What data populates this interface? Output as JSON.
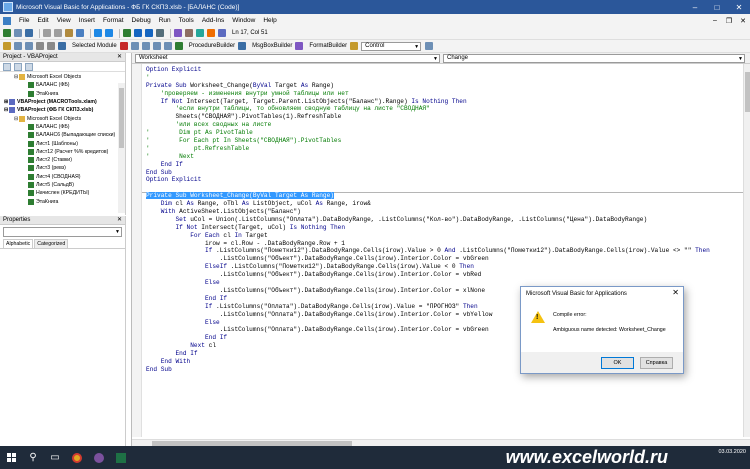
{
  "window": {
    "title": "Microsoft Visual Basic for Applications - ФБ ГК СКПЗ.xlsb - [БАЛАНС (Code)]"
  },
  "menu": [
    "File",
    "Edit",
    "View",
    "Insert",
    "Format",
    "Debug",
    "Run",
    "Tools",
    "Add-Ins",
    "Window",
    "Help"
  ],
  "toolbar": {
    "status": "Ln 17, Col 51"
  },
  "toolbar2": {
    "selected_module": "Selected Module",
    "proc_builder": "ProcedureBuilder",
    "msgbox_builder": "MsgBoxBuilder",
    "form_builder": "FormatBuilder",
    "control": "Control"
  },
  "project": {
    "title": "Project - VBAProject",
    "items": [
      "Microsoft Excel Objects",
      "БАЛАНС (ФБ)",
      "ЭтаКнига",
      "VBAProject (MACROTools.xlam)",
      "VBAProject (ФБ ГК СКПЗ.xlsb)",
      "Microsoft Excel Objects",
      "БАЛАНС (ФБ)",
      "БАЛАНС6 (Выпадающие списки)",
      "Лист1 (Шаблоны)",
      "Лист12 (Расчет %% кредитов)",
      "Лист2 (Ставки)",
      "Лист3 (ревз)",
      "Лист4 (СВОДНАЯ)",
      "Лист5 (СальдВ)",
      "Начислен (КРЕДИТЫ)",
      "ЭтаКнига"
    ]
  },
  "properties": {
    "title": "Properties",
    "tab_alpha": "Alphabetic",
    "tab_cat": "Categorized"
  },
  "code": {
    "object": "Worksheet",
    "procedure": "Change",
    "lines": [
      "Option Explicit",
      "'",
      "Private Sub Worksheet_Change(ByVal Target As Range)",
      "    'проверяем - изменения внутри умной таблицы или нет",
      "    If Not Intersect(Target, Target.Parent.ListObjects(\"Баланс\").Range) Is Nothing Then",
      "        'если внутри таблицы, то обновляем сводную таблицу на листе \"СВОДНАЯ\"",
      "        Sheets(\"СВОДНАЯ\").PivotTables(1).RefreshTable",
      "        'или всех сводных на листе",
      "'        Dim pt As PivotTable",
      "'        For Each pt In Sheets(\"СВОДНАЯ\").PivotTables",
      "'            pt.RefreshTable",
      "'        Next",
      "    End If",
      "End Sub",
      "Option Explicit",
      "",
      "Private Sub Worksheet_Change(ByVal Target As Range)",
      "    Dim cl As Range, oTbl As ListObject, uCol As Range, irow&",
      "    With ActiveSheet.ListObjects(\"Баланс\")",
      "        Set uCol = Union(.ListColumns(\"Оплата\").DataBodyRange, .ListColumns(\"Кол-во\").DataBodyRange, .ListColumns(\"Цена\").DataBodyRange)",
      "        If Not Intersect(Target, uCol) Is Nothing Then",
      "            For Each cl In Target",
      "                irow = cl.Row - .DataBodyRange.Row + 1",
      "                If .ListColumns(\"Пометки12\").DataBodyRange.Cells(irow).Value > 0 And .ListColumns(\"Пометки12\").DataBodyRange.Cells(irow).Value <> \"\" Then",
      "                    .ListColumns(\"Объект\").DataBodyRange.Cells(irow).Interior.Color = vbGreen",
      "                ElseIf .ListColumns(\"Пометки12\").DataBodyRange.Cells(irow).Value < 0 Then",
      "                    .ListColumns(\"Объект\").DataBodyRange.Cells(irow).Interior.Color = vbRed",
      "                Else",
      "                    .ListColumns(\"Объект\").DataBodyRange.Cells(irow).Interior.Color = xlNone",
      "                End If",
      "                If .ListColumns(\"Оплата\").DataBodyRange.Cells(irow).Value = \"ПРОГНОЗ\" Then",
      "                    .ListColumns(\"Оплата\").DataBodyRange.Cells(irow).Interior.Color = vbYellow",
      "                Else",
      "                    .ListColumns(\"Оплата\").DataBodyRange.Cells(irow).Interior.Color = vbGreen",
      "                End If",
      "            Next cl",
      "        End If",
      "    End With",
      "End Sub"
    ]
  },
  "dialog": {
    "title": "Microsoft Visual Basic for Applications",
    "line1": "Compile error:",
    "line2": "Ambiguous name detected: Worksheet_Change",
    "ok": "OK",
    "help": "Справка"
  },
  "taskbar": {
    "watermark": "www.excelworld.ru",
    "date": "03.03.2020"
  }
}
